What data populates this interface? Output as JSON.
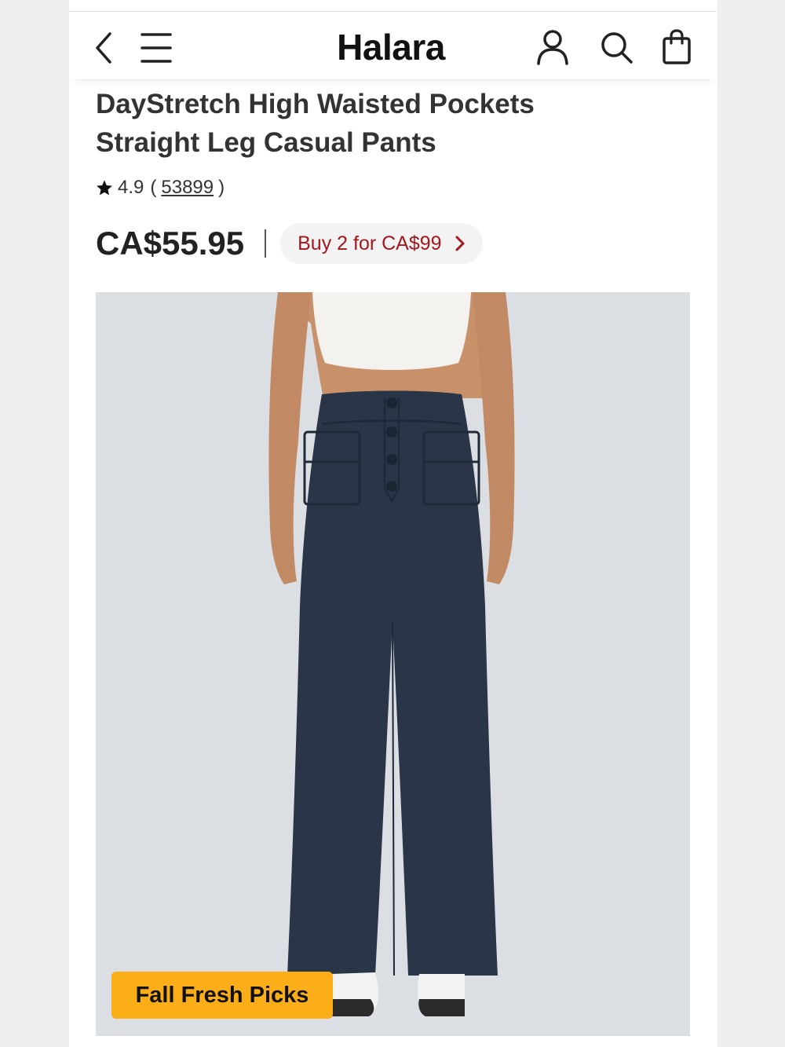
{
  "header": {
    "brand": "Halara",
    "icons": [
      "chevron-left-icon",
      "menu-icon",
      "user-icon",
      "search-icon",
      "shopping-bag-icon"
    ]
  },
  "product": {
    "title_line1": "DayStretch High Waisted Pockets",
    "title_line2": "Straight Leg Casual Pants",
    "rating": "4.9",
    "rating_open": "(",
    "review_count": "53899",
    "rating_close": ")",
    "price": "CA$55.95",
    "promo": "Buy 2 for CA$99",
    "image_tag": "Fall Fresh Picks"
  },
  "colors": {
    "promo_text": "#a3171d",
    "tag_bg": "#fbae17",
    "image_bg": "#dbdee3",
    "pants": "#2a3648"
  }
}
